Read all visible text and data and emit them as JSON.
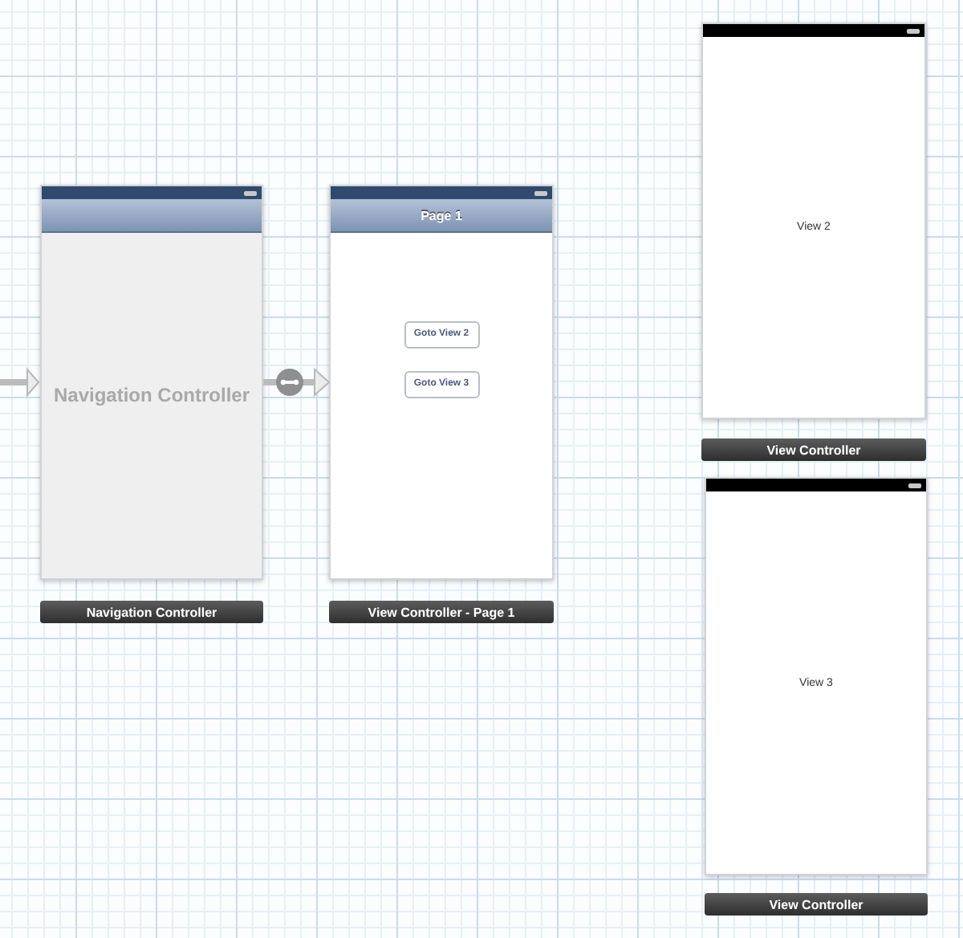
{
  "scenes": [
    {
      "kind": "navigation",
      "nav_bar": true,
      "placeholder": "Navigation Controller",
      "label": "Navigation Controller",
      "entry_arrow": true,
      "segue_out": true
    },
    {
      "kind": "view",
      "nav_bar": true,
      "nav_title": "Page 1",
      "buttons": [
        "Goto View 2",
        "Goto View 3"
      ],
      "label": "View Controller - Page 1"
    },
    {
      "kind": "view",
      "nav_bar": false,
      "center_text": "View 2",
      "label": "View Controller"
    },
    {
      "kind": "view",
      "nav_bar": false,
      "center_text": "View 3",
      "label": "View Controller"
    }
  ]
}
